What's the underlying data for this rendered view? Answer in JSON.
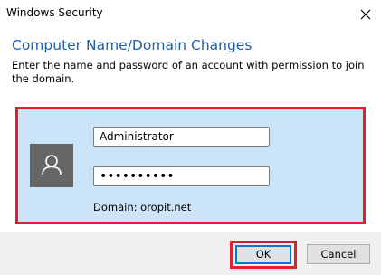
{
  "window": {
    "title": "Windows Security"
  },
  "dialog": {
    "heading": "Computer Name/Domain Changes",
    "description": "Enter the name and password of an account with permission to join the domain."
  },
  "credentials": {
    "username": "Administrator",
    "password": "••••••••••",
    "domain_text": "Domain: oropit.net"
  },
  "buttons": {
    "ok": "OK",
    "cancel": "Cancel"
  },
  "icons": {
    "close": "close-icon",
    "avatar": "user-icon"
  },
  "colors": {
    "heading": "#1f5fa8",
    "panel_background": "#cce4f7",
    "highlight_border": "#e0202c",
    "avatar_background": "#666666",
    "default_button_border": "#0078d7"
  }
}
